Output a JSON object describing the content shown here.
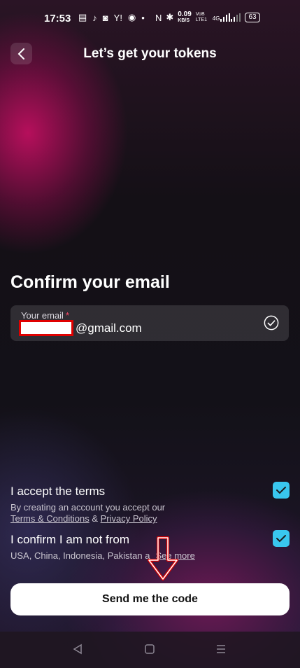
{
  "status_bar": {
    "time": "17:53",
    "speed": "0.09",
    "speed_unit": "KB/S",
    "volte": "VoB LTE1",
    "network": "4G",
    "battery": "63"
  },
  "header": {
    "title": "Let’s get your tokens"
  },
  "main": {
    "heading": "Confirm your email",
    "email": {
      "label": "Your email",
      "required_mark": "*",
      "domain": "@gmail.com"
    },
    "terms": {
      "title": "I accept the terms",
      "desc": "By creating an account you accept our",
      "link1": "Terms & Conditions",
      "amp": "&",
      "link2": "Privacy Policy"
    },
    "residence": {
      "title": "I confirm I am not from",
      "desc": "USA, China, Indonesia, Pakistan a",
      "link": "See more"
    },
    "submit_label": "Send me the code"
  },
  "colors": {
    "accent_checkbox": "#39c7ee",
    "annotation_red": "#e00000"
  },
  "icons": [
    "back-icon",
    "check-circle-icon",
    "checkbox-check-icon",
    "nav-back-icon",
    "nav-home-icon",
    "nav-menu-icon"
  ]
}
